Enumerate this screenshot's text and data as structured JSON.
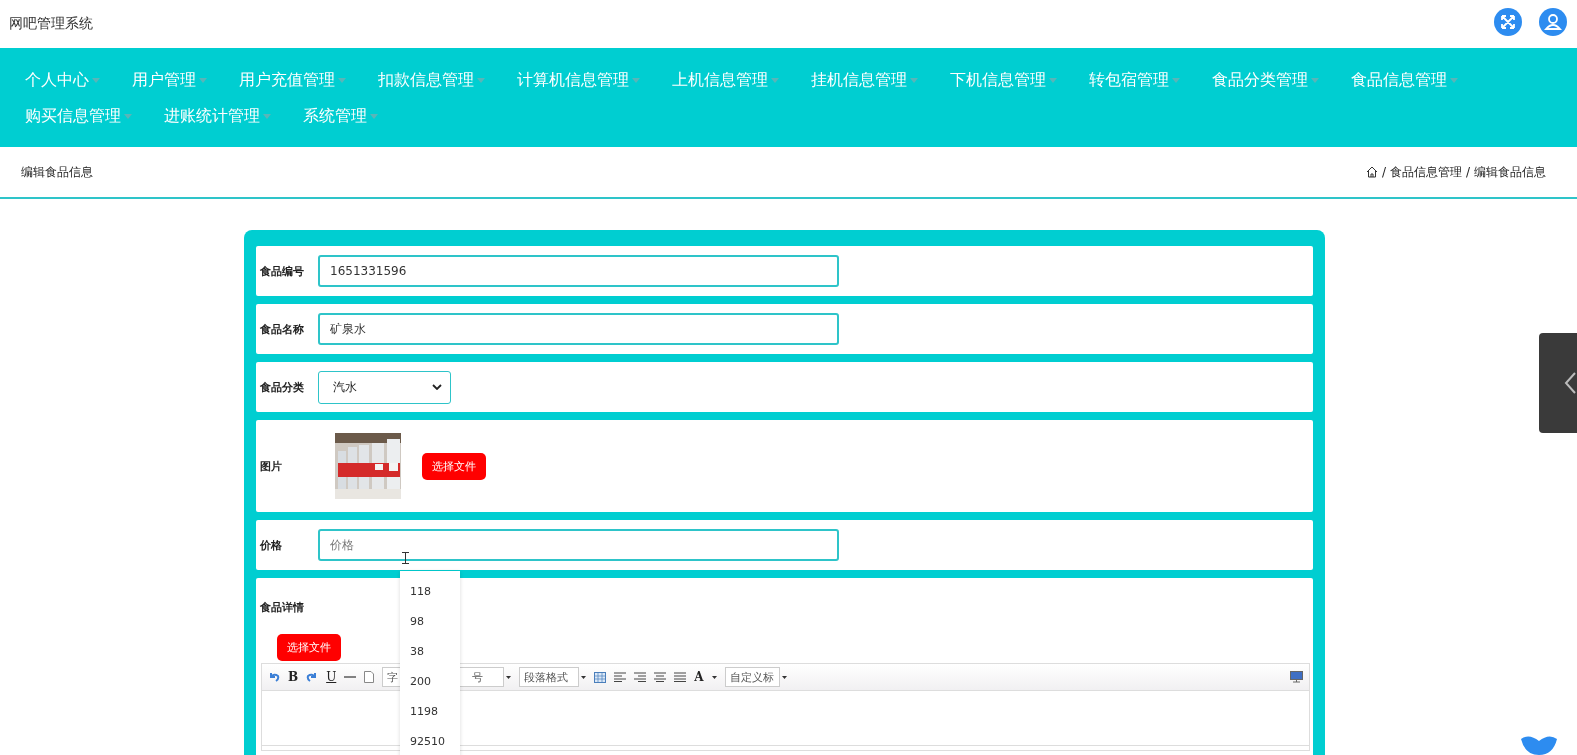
{
  "header": {
    "title": "网吧管理系统"
  },
  "nav": [
    {
      "label": "个人中心"
    },
    {
      "label": "用户管理"
    },
    {
      "label": "用户充值管理"
    },
    {
      "label": "扣款信息管理"
    },
    {
      "label": "计算机信息管理"
    },
    {
      "label": "上机信息管理"
    },
    {
      "label": "挂机信息管理"
    },
    {
      "label": "下机信息管理"
    },
    {
      "label": "转包宿管理"
    },
    {
      "label": "食品分类管理"
    },
    {
      "label": "食品信息管理"
    },
    {
      "label": "购买信息管理"
    },
    {
      "label": "进账统计管理"
    },
    {
      "label": "系统管理"
    }
  ],
  "page_title": "编辑食品信息",
  "breadcrumb": [
    {
      "separator": "/",
      "label": "食品信息管理"
    },
    {
      "separator": "/",
      "label": "编辑食品信息"
    }
  ],
  "form": {
    "fields": [
      {
        "kind": "text",
        "label": "食品编号",
        "value": "1651331596"
      },
      {
        "kind": "text",
        "label": "食品名称",
        "value": "矿泉水"
      },
      {
        "kind": "select",
        "label": "食品分类",
        "value": "汽水"
      },
      {
        "label": "图片",
        "button": "选择文件"
      },
      {
        "kind": "text",
        "label": "价格",
        "placeholder": "价格"
      },
      {
        "kind": "editor",
        "label": "食品详情",
        "button": "选择文件",
        "toolbar": {
          "bold": "B",
          "underline": "U",
          "font": "字",
          "size": "号",
          "paragraph": "段落格式",
          "font_color": "A",
          "custom_title": "自定义标"
        }
      }
    ]
  },
  "autocomplete": [
    "118",
    "98",
    "38",
    "200",
    "1198",
    "92510"
  ]
}
